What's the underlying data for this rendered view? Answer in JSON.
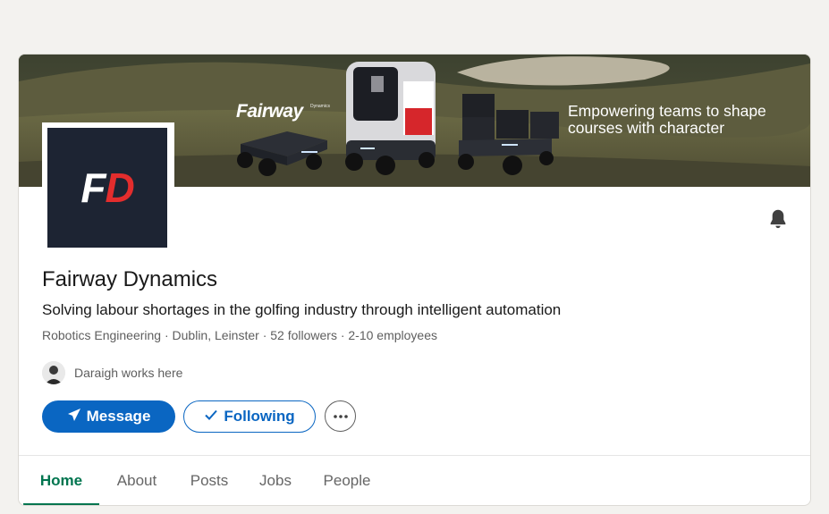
{
  "banner": {
    "brand": "Fairway",
    "brand_sub": "Dynamics",
    "headline_line1": "Empowering teams to shape",
    "headline_line2": "courses with character"
  },
  "logo": {
    "letter_1": "F",
    "letter_2": "D"
  },
  "company": {
    "name": "Fairway Dynamics",
    "tagline": "Solving labour shortages in the golfing industry through intelligent automation",
    "meta": "Robotics Engineering · Dublin, Leinster · 52 followers · 2-10 employees",
    "works_here": "Daraigh works here"
  },
  "actions": {
    "message_label": "Message",
    "following_label": "Following"
  },
  "tabs": [
    {
      "label": "Home",
      "active": true
    },
    {
      "label": "About",
      "active": false
    },
    {
      "label": "Posts",
      "active": false
    },
    {
      "label": "Jobs",
      "active": false
    },
    {
      "label": "People",
      "active": false
    }
  ],
  "icons": {
    "bell": "bell-icon",
    "message": "paper-plane-icon",
    "following": "checkmark-icon",
    "more": "ellipsis-icon"
  },
  "colors": {
    "primary": "#0a66c2",
    "tab_active": "#01754f",
    "logo_bg": "#1d2433",
    "logo_accent": "#e32d2d"
  }
}
